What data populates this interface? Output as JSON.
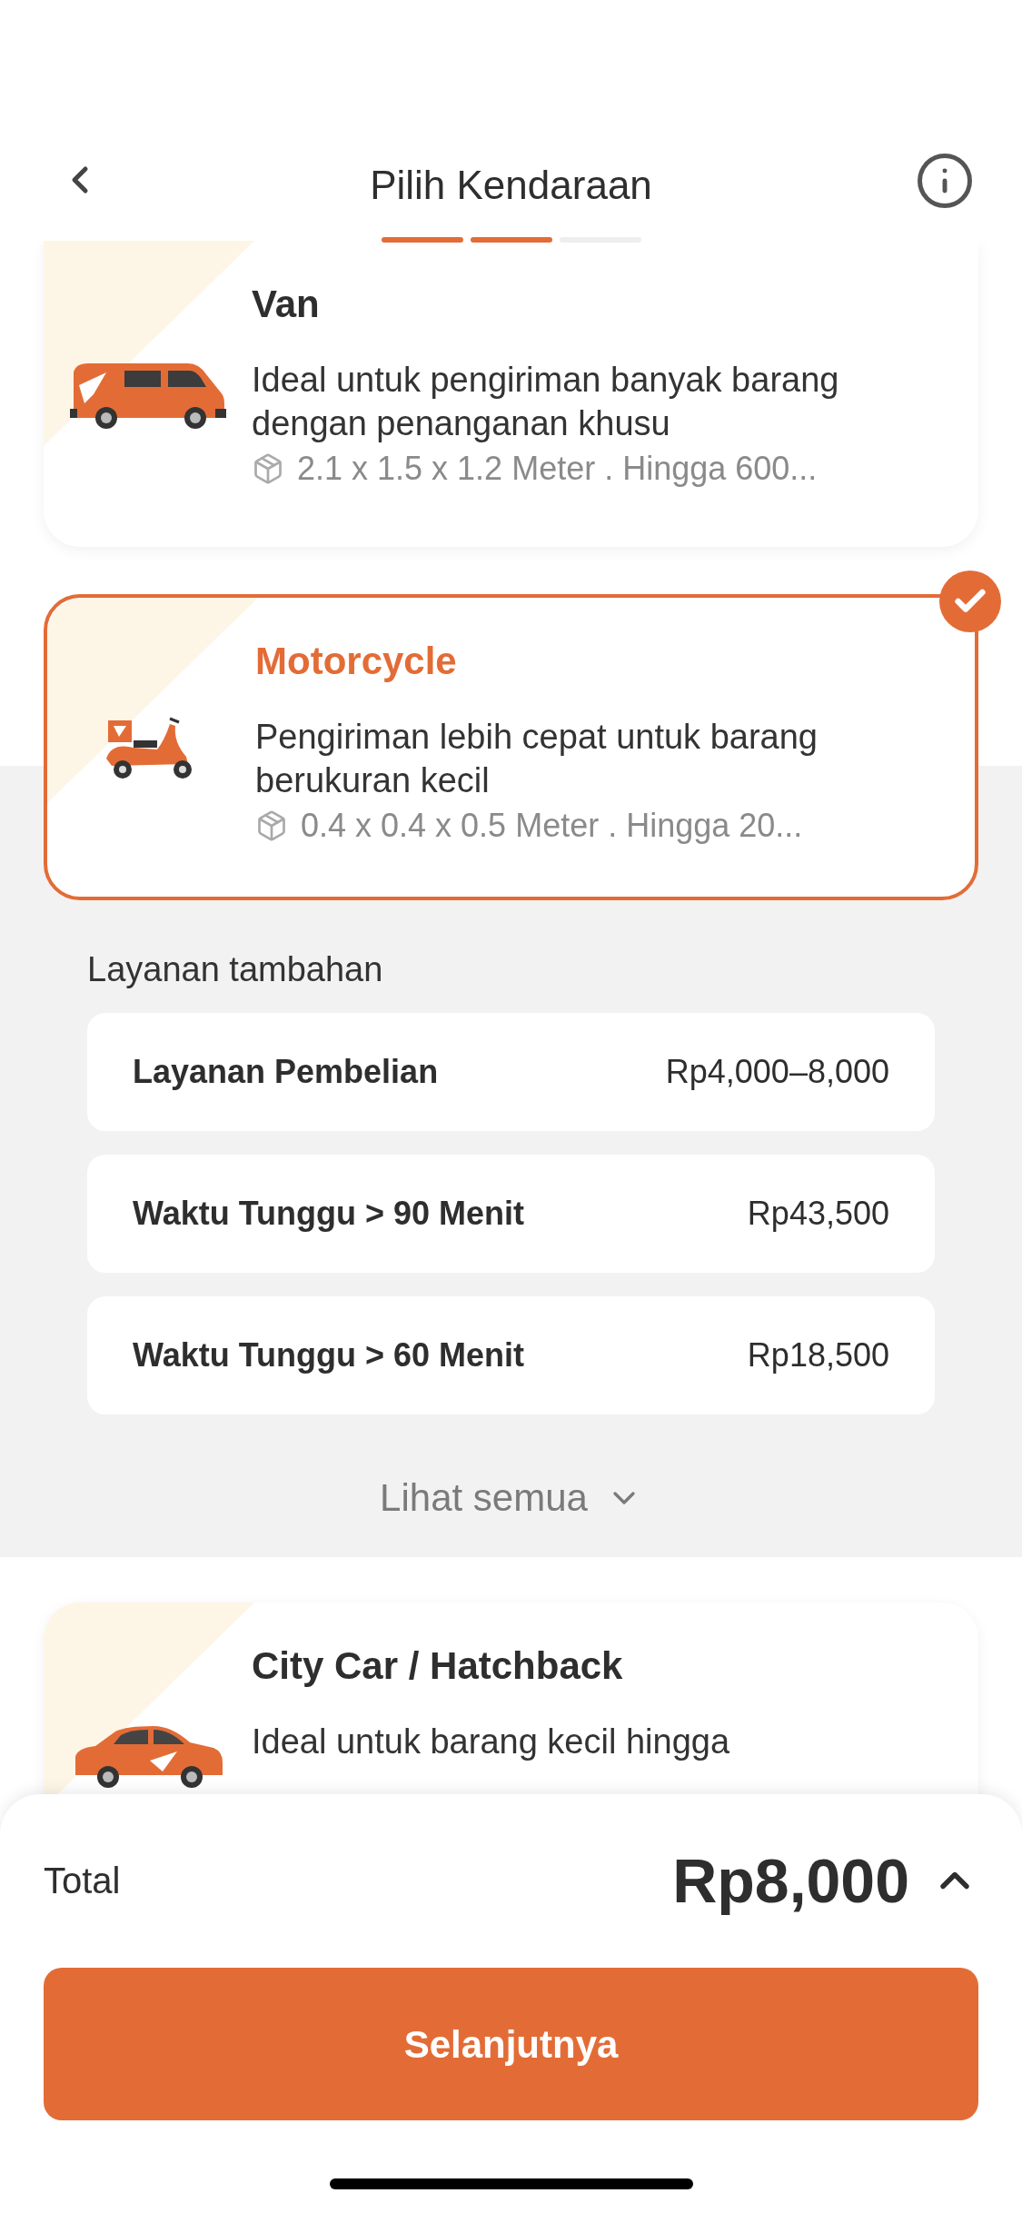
{
  "header": {
    "title": "Pilih Kendaraan",
    "steps": [
      {
        "done": true
      },
      {
        "done": true
      },
      {
        "done": false
      }
    ]
  },
  "vehicles": [
    {
      "kind": "van",
      "name": "Van",
      "description": "Ideal untuk pengiriman banyak barang dengan penanganan khusu",
      "specs": "2.1 x 1.5 x 1.2 Meter . Hingga 600...",
      "selected": false
    },
    {
      "kind": "motorcycle",
      "name": "Motorcycle",
      "description": "Pengiriman lebih cepat untuk barang berukuran kecil",
      "specs": "0.4 x 0.4 x 0.5 Meter . Hingga 20...",
      "selected": true
    },
    {
      "kind": "car",
      "name": "City Car / Hatchback",
      "description": "Ideal untuk barang kecil hingga",
      "selected": false
    }
  ],
  "addons": {
    "title": "Layanan tambahan",
    "items": [
      {
        "name": "Layanan Pembelian",
        "price": "Rp4,000–8,000"
      },
      {
        "name": "Waktu Tunggu > 90 Menit",
        "price": "Rp43,500"
      },
      {
        "name": "Waktu Tunggu > 60 Menit",
        "price": "Rp18,500"
      }
    ],
    "show_all": "Lihat semua"
  },
  "footer": {
    "total_label": "Total",
    "total": "Rp8,000",
    "button": "Selanjutnya"
  }
}
